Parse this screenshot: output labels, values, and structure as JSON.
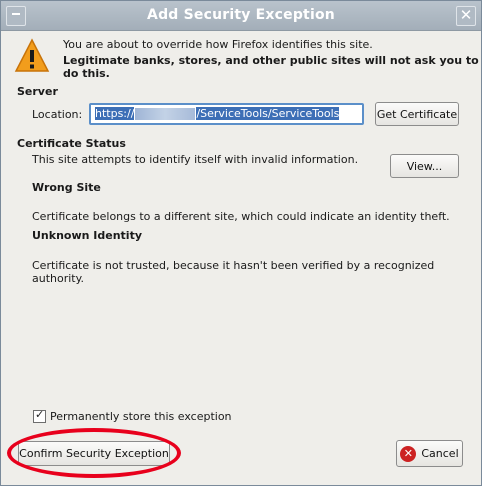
{
  "window": {
    "title": "Add Security Exception"
  },
  "intro": {
    "line1": "You are about to override how Firefox identifies this site.",
    "line2": "Legitimate banks, stores, and other public sites will not ask you to do this."
  },
  "server": {
    "heading": "Server",
    "location_label": "Location:",
    "location_prefix": "https://",
    "location_suffix": "/ServiceTools/ServiceTools",
    "get_certificate_label": "Get Certificate"
  },
  "status": {
    "heading": "Certificate Status",
    "description": "This site attempts to identify itself with invalid information.",
    "view_label": "View...",
    "issues": [
      {
        "title": "Wrong Site",
        "text": "Certificate belongs to a different site, which could indicate an identity theft."
      },
      {
        "title": "Unknown Identity",
        "text": "Certificate is not trusted, because it hasn't been verified by a recognized authority."
      }
    ]
  },
  "footer": {
    "store_label": "Permanently store this exception",
    "store_checked": true,
    "confirm_label": "Confirm Security Exception",
    "cancel_label": "Cancel"
  },
  "colors": {
    "highlight": "#e8001c",
    "selection": "#3d6fb6",
    "title_bar": "#aab4bf"
  },
  "icons": {
    "warning": "warning-triangle-icon",
    "cancel": "cancel-icon",
    "close": "close-icon"
  }
}
